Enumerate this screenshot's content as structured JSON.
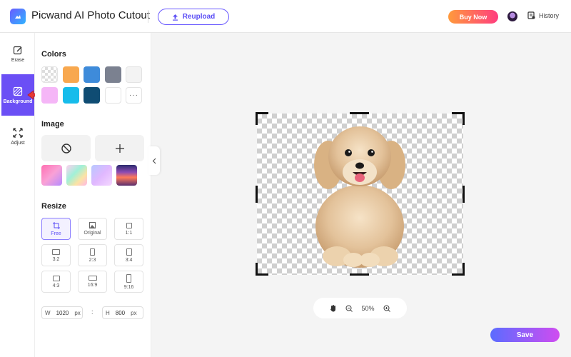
{
  "header": {
    "app_title": "Picwand AI Photo Cutout",
    "reupload_label": "Reupload",
    "buy_now_label": "Buy Now",
    "history_label": "History"
  },
  "tools": [
    {
      "label": "Erase",
      "icon": "erase-icon",
      "active": false
    },
    {
      "label": "Background",
      "icon": "background-icon",
      "active": true
    },
    {
      "label": "Adjust",
      "icon": "adjust-icon",
      "active": false
    }
  ],
  "panel": {
    "colors_title": "Colors",
    "colors": [
      "transparent",
      "#F8A84F",
      "#3E8BDA",
      "#7B8190",
      "#F3F3F3",
      "#F5B6F7",
      "#16BCEB",
      "#0F4C73",
      "#FFFFFF",
      "more"
    ],
    "more_label": "···",
    "image_title": "Image",
    "image_thumbs": [
      "pink-gradient",
      "pastel-rainbow",
      "lilac-sparkle",
      "sunset"
    ],
    "resize_title": "Resize",
    "resize_options": [
      {
        "label": "Free",
        "active": true
      },
      {
        "label": "Original",
        "active": false
      },
      {
        "label": "1:1",
        "active": false
      },
      {
        "label": "3:2",
        "active": false
      },
      {
        "label": "2:3",
        "active": false
      },
      {
        "label": "3:4",
        "active": false
      },
      {
        "label": "4:3",
        "active": false
      },
      {
        "label": "16:9",
        "active": false
      },
      {
        "label": "9:16",
        "active": false
      }
    ],
    "width_label": "W",
    "width_value": "1020",
    "height_label": "H",
    "height_value": "800",
    "unit": "px",
    "separator": ":"
  },
  "canvas": {
    "zoom_level": "50%",
    "image_subject": "puppy",
    "background": "transparent"
  },
  "footer": {
    "save_label": "Save"
  },
  "colors": {
    "accent": "#6B4FF5",
    "buy_now_gradient": [
      "#FF9A3C",
      "#FF3D7F"
    ],
    "save_gradient": [
      "#5B6CFF",
      "#D04CF0"
    ]
  }
}
